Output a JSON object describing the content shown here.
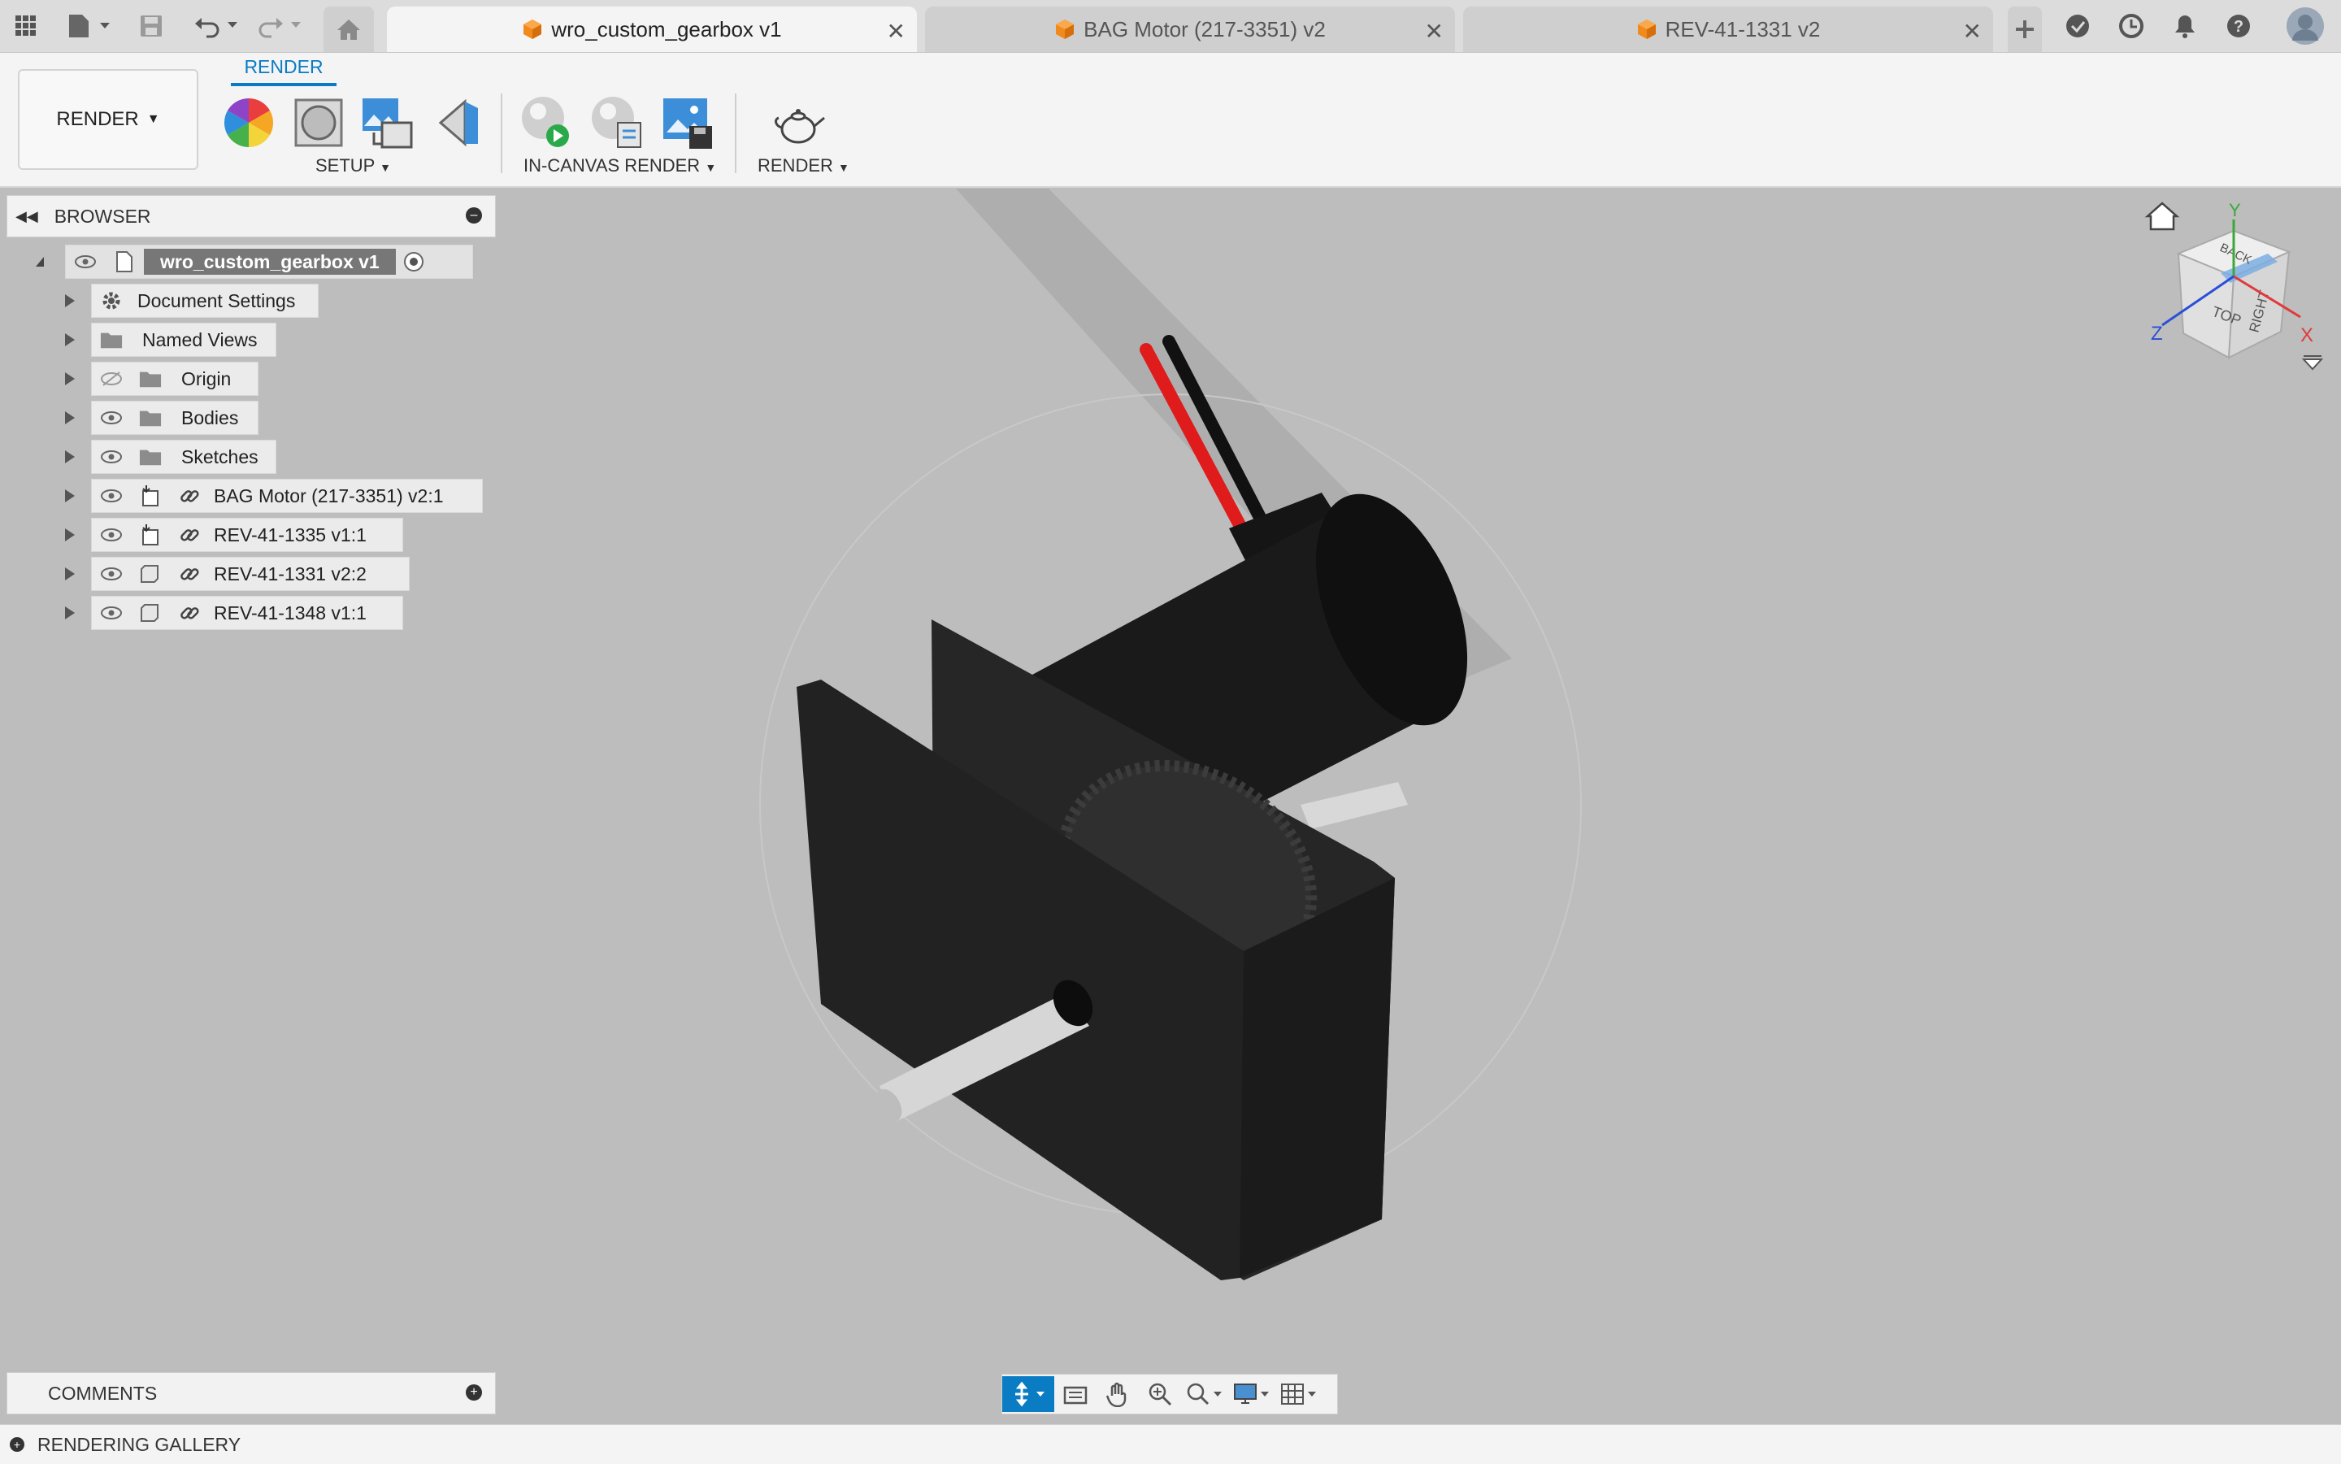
{
  "tabs": [
    {
      "label": "wro_custom_gearbox v1",
      "active": true
    },
    {
      "label": "BAG Motor (217-3351) v2",
      "active": false
    },
    {
      "label": "REV-41-1331 v2",
      "active": false
    }
  ],
  "toolbar": {
    "icons": [
      "app-grid-icon",
      "file-icon",
      "save-icon",
      "undo-icon",
      "redo-icon",
      "home-icon",
      "new-tab-icon",
      "extensions-icon",
      "job-status-icon",
      "notifications-icon",
      "help-icon",
      "user-avatar"
    ]
  },
  "ribbon": {
    "workspace": "RENDER",
    "active_tab": "RENDER",
    "groups": {
      "setup": "SETUP",
      "in_canvas": "IN-CANVAS RENDER",
      "render": "RENDER"
    }
  },
  "browser": {
    "title": "BROWSER",
    "root": "wro_custom_gearbox v1",
    "items": [
      {
        "label": "Document Settings"
      },
      {
        "label": "Named Views"
      },
      {
        "label": "Origin"
      },
      {
        "label": "Bodies"
      },
      {
        "label": "Sketches"
      },
      {
        "label": "BAG Motor (217-3351) v2:1"
      },
      {
        "label": "REV-41-1335 v1:1"
      },
      {
        "label": "REV-41-1331 v2:2"
      },
      {
        "label": "REV-41-1348 v1:1"
      }
    ]
  },
  "comments": {
    "title": "COMMENTS"
  },
  "gallery": {
    "title": "RENDERING GALLERY"
  },
  "viewcube": {
    "top": "TOP",
    "right": "RIGHT",
    "back": "BACK",
    "axis_x": "X",
    "axis_y": "Y",
    "axis_z": "Z"
  },
  "colors": {
    "accent": "#0a7cc4",
    "canvas": "#bdbdbd",
    "model": "#1e1e1e",
    "wire_red": "#e01b1b"
  }
}
